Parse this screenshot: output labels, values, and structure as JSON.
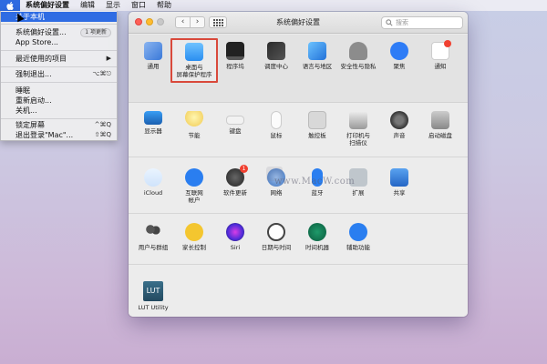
{
  "menubar": {
    "app_name": "系统偏好设置",
    "items": [
      "编辑",
      "显示",
      "窗口",
      "帮助"
    ]
  },
  "apple_menu": {
    "about": "关于本机",
    "system_prefs": "系统偏好设置...",
    "system_prefs_badge": "1 项更新",
    "app_store": "App Store...",
    "recent_items": "最近使用的项目",
    "force_quit": "强制退出...",
    "force_quit_shortcut": "⌥⌘⎋",
    "sleep": "睡眠",
    "restart": "重新启动...",
    "shutdown": "关机...",
    "lock_screen": "锁定屏幕",
    "lock_screen_shortcut": "^⌘Q",
    "logout": "退出登录\"Mac\"...",
    "logout_shortcut": "⇧⌘Q"
  },
  "window": {
    "title": "系统偏好设置",
    "search_placeholder": "搜索"
  },
  "rows": [
    [
      {
        "label": "通用",
        "icon": "general-icon"
      },
      {
        "label": "桌面与\n屏幕保护程序",
        "icon": "desktop-screensaver-icon",
        "selected": true
      },
      {
        "label": "程序坞",
        "icon": "dock-icon"
      },
      {
        "label": "调度中心",
        "icon": "mission-control-icon"
      },
      {
        "label": "语言与地区",
        "icon": "language-region-icon"
      },
      {
        "label": "安全性与隐私",
        "icon": "security-privacy-icon"
      },
      {
        "label": "聚焦",
        "icon": "spotlight-icon"
      },
      {
        "label": "通知",
        "icon": "notifications-icon"
      }
    ],
    [
      {
        "label": "显示器",
        "icon": "displays-icon"
      },
      {
        "label": "节能",
        "icon": "energy-saver-icon"
      },
      {
        "label": "键盘",
        "icon": "keyboard-icon"
      },
      {
        "label": "鼠标",
        "icon": "mouse-icon"
      },
      {
        "label": "触控板",
        "icon": "trackpad-icon"
      },
      {
        "label": "打印机与\n扫描仪",
        "icon": "printers-scanners-icon"
      },
      {
        "label": "声音",
        "icon": "sound-icon"
      },
      {
        "label": "启动磁盘",
        "icon": "startup-disk-icon"
      }
    ],
    [
      {
        "label": "iCloud",
        "icon": "icloud-icon"
      },
      {
        "label": "互联网\n帐户",
        "icon": "internet-accounts-icon"
      },
      {
        "label": "软件更新",
        "icon": "software-update-icon",
        "badge": "1"
      },
      {
        "label": "网络",
        "icon": "network-icon"
      },
      {
        "label": "蓝牙",
        "icon": "bluetooth-icon"
      },
      {
        "label": "扩展",
        "icon": "extensions-icon"
      },
      {
        "label": "共享",
        "icon": "sharing-icon"
      }
    ],
    [
      {
        "label": "用户与群组",
        "icon": "users-groups-icon"
      },
      {
        "label": "家长控制",
        "icon": "parental-controls-icon"
      },
      {
        "label": "Siri",
        "icon": "siri-icon"
      },
      {
        "label": "日期与时间",
        "icon": "date-time-icon"
      },
      {
        "label": "时间机器",
        "icon": "time-machine-icon"
      },
      {
        "label": "辅助功能",
        "icon": "accessibility-icon"
      }
    ],
    [
      {
        "label": "LUT Utility",
        "icon": "lut-utility-icon",
        "icon_text": "LUT"
      }
    ]
  ],
  "watermark": "www.MacW.com"
}
